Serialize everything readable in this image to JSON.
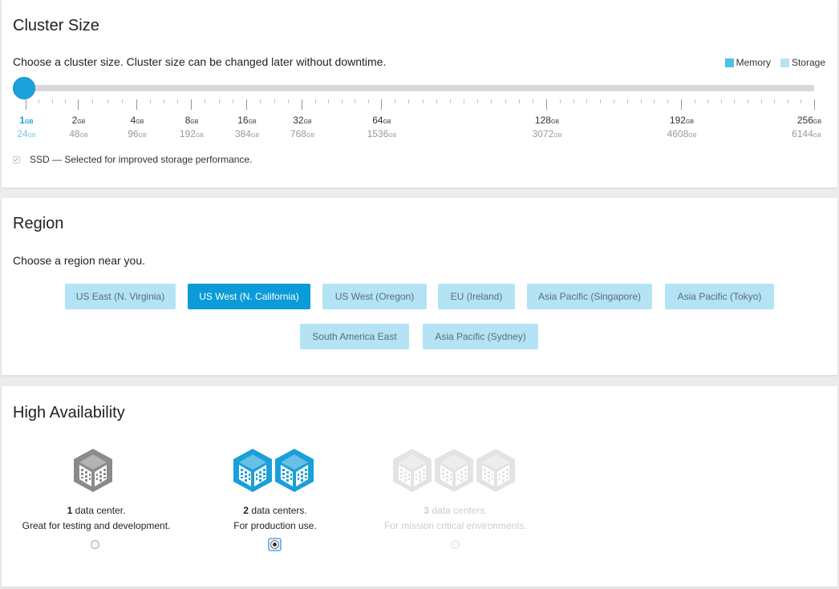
{
  "cluster_size": {
    "title": "Cluster Size",
    "description": "Choose a cluster size. Cluster size can be changed later without downtime.",
    "legend": [
      {
        "label": "Memory",
        "color": "#4cc1ec"
      },
      {
        "label": "Storage",
        "color": "#b6e2f4"
      }
    ],
    "selected_index": 0,
    "unit": "GB",
    "sizes": [
      {
        "memory": "1",
        "storage": "24"
      },
      {
        "memory": "2",
        "storage": "48"
      },
      {
        "memory": "4",
        "storage": "96"
      },
      {
        "memory": "8",
        "storage": "192"
      },
      {
        "memory": "16",
        "storage": "384"
      },
      {
        "memory": "32",
        "storage": "768"
      },
      {
        "memory": "64",
        "storage": "1536"
      },
      {
        "memory": "128",
        "storage": "3072"
      },
      {
        "memory": "192",
        "storage": "4608"
      },
      {
        "memory": "256",
        "storage": "6144"
      }
    ],
    "ssd_label": "SSD — Selected for improved storage performance.",
    "ssd_checked": true
  },
  "region": {
    "title": "Region",
    "description": "Choose a region near you.",
    "selected": "US West (N. California)",
    "options": [
      "US East (N. Virginia)",
      "US West (N. California)",
      "US West (Oregon)",
      "EU (Ireland)",
      "Asia Pacific (Singapore)",
      "Asia Pacific (Tokyo)",
      "South America East",
      "Asia Pacific (Sydney)"
    ]
  },
  "high_availability": {
    "title": "High Availability",
    "selected_index": 1,
    "options": [
      {
        "count": "1",
        "count_label": "data center.",
        "description": "Great for testing and development.",
        "enabled": true,
        "icon": "datacenter-icon"
      },
      {
        "count": "2",
        "count_label": "data centers.",
        "description": "For production use.",
        "enabled": true,
        "icon": "datacenter-icon"
      },
      {
        "count": "3",
        "count_label": "data centers.",
        "description": "For mission critical environments.",
        "enabled": false,
        "icon": "datacenter-icon"
      }
    ]
  }
}
